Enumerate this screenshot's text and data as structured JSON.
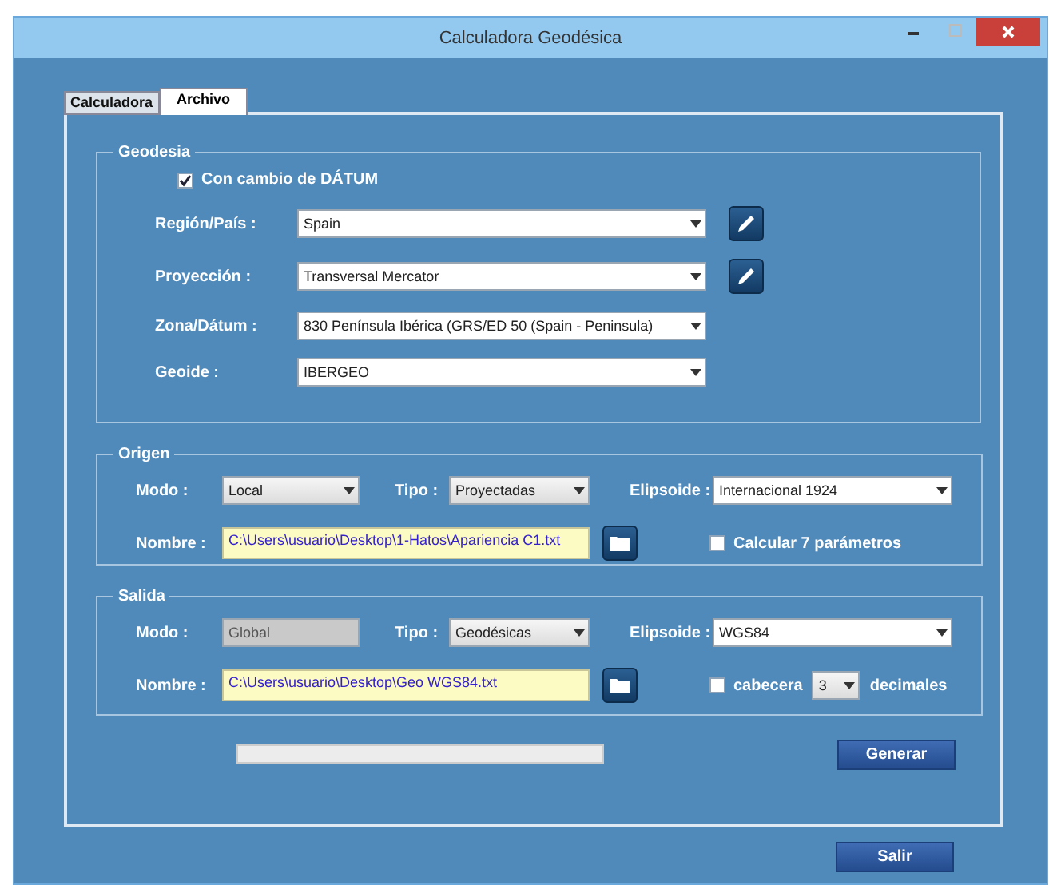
{
  "window": {
    "title": "Calculadora Geodésica"
  },
  "tabs": [
    {
      "label": "Calculadora",
      "selected": false
    },
    {
      "label": "Archivo",
      "selected": true
    }
  ],
  "geodesia": {
    "title": "Geodesia",
    "datum_change": {
      "label": "Con cambio de DÁTUM",
      "checked": true
    },
    "fields": [
      {
        "label": "Región/País :",
        "value": "Spain",
        "edit_button": true
      },
      {
        "label": "Proyección :",
        "value": "Transversal Mercator",
        "edit_button": true
      },
      {
        "label": "Zona/Dátum :",
        "value": "830 Península Ibérica (GRS/ED 50 (Spain - Peninsula)",
        "edit_button": false
      },
      {
        "label": "Geoide :",
        "value": "IBERGEO",
        "edit_button": false
      }
    ]
  },
  "origen": {
    "title": "Origen",
    "modo": {
      "label": "Modo :",
      "value": "Local",
      "disabled": false
    },
    "tipo": {
      "label": "Tipo :",
      "value": "Proyectadas",
      "disabled": false
    },
    "elipsoide": {
      "label": "Elipsoide :",
      "value": "Internacional 1924",
      "disabled": false
    },
    "nombre": {
      "label": "Nombre :",
      "value": "C:\\Users\\usuario\\Desktop\\1-Hatos\\Apariencia C1.txt"
    },
    "option": {
      "label": "Calcular 7 parámetros",
      "checked": false
    }
  },
  "salida": {
    "title": "Salida",
    "modo": {
      "label": "Modo :",
      "value": "Global",
      "disabled": true
    },
    "tipo": {
      "label": "Tipo :",
      "value": "Geodésicas",
      "disabled": false
    },
    "elipsoide": {
      "label": "Elipsoide :",
      "value": "WGS84",
      "disabled": false
    },
    "nombre": {
      "label": "Nombre :",
      "value": "C:\\Users\\usuario\\Desktop\\Geo WGS84.txt"
    },
    "cabecera": {
      "label": "cabecera",
      "checked": false
    },
    "decimales": {
      "value": "3",
      "label": "decimales"
    }
  },
  "progress": {
    "level": 0
  },
  "generate_button": "Generar",
  "exit_button": "Salir"
}
